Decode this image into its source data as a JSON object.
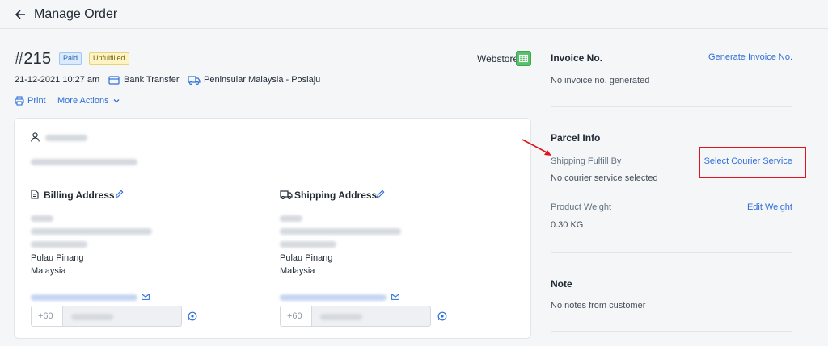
{
  "header": {
    "title": "Manage Order"
  },
  "order": {
    "number": "#215",
    "badges": {
      "paid": "Paid",
      "unfulfilled": "Unfulfilled"
    },
    "channel": "Webstore",
    "date": "21-12-2021 10:27 am",
    "payment_method": "Bank Transfer",
    "shipping_method": "Peninsular Malaysia - Poslaju",
    "actions": {
      "print": "Print",
      "more": "More Actions"
    }
  },
  "customer": {
    "billing": {
      "title": "Billing Address",
      "state": "Pulau Pinang",
      "country": "Malaysia"
    },
    "shipping": {
      "title": "Shipping Address",
      "state": "Pulau Pinang",
      "country": "Malaysia"
    },
    "phone_prefix": "+60"
  },
  "sidebar": {
    "invoice": {
      "title": "Invoice No.",
      "action": "Generate Invoice No.",
      "status": "No invoice no. generated"
    },
    "parcel": {
      "title": "Parcel Info",
      "fulfill_label": "Shipping Fulfill By",
      "fulfill_value": "No courier service selected",
      "courier_action": "Select Courier Service",
      "weight_label": "Product Weight",
      "weight_action": "Edit Weight",
      "weight_value": "0.30 KG"
    },
    "note": {
      "title": "Note",
      "text": "No notes from customer"
    }
  },
  "colors": {
    "link": "#2f6fd6",
    "highlight": "#e0141e",
    "paid_bg": "#dbeafe",
    "unfulfilled_bg": "#fdf3c4"
  },
  "icons": [
    "back-arrow-icon",
    "card-icon",
    "truck-icon",
    "print-icon",
    "chevron-down-icon",
    "user-icon",
    "document-icon",
    "edit-icon",
    "mail-icon",
    "whatsapp-icon",
    "webstore-icon"
  ]
}
